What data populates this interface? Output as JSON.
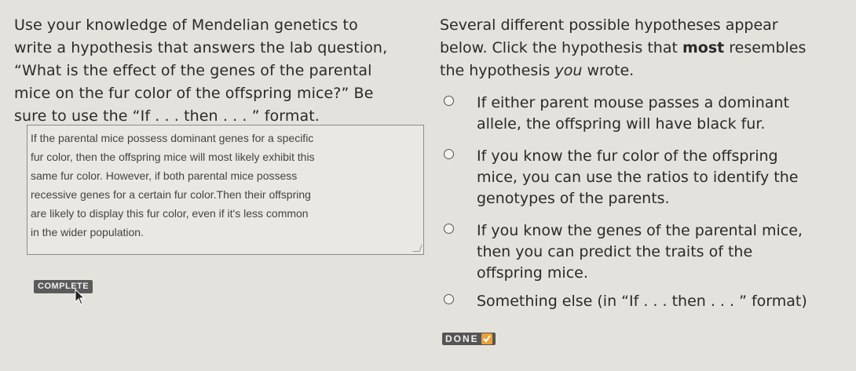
{
  "question": {
    "line1": "Use your knowledge of Mendelian genetics to",
    "line2": "write a hypothesis that answers the lab question,",
    "line3": "“What is the effect of the genes of the parental",
    "line4": "mice on the fur color of the offspring mice?” Be",
    "line5": "sure to use the “If . . . then . . . ” format."
  },
  "answer": {
    "text": "If the parental mice possess dominant genes for a specific\nfur color, then the offspring mice will most likely exhibit this\nsame fur color. However, if both parental mice possess\nrecessive genes for a certain fur color.Then their offspring\nare likely to display this fur color, even if it's less common\nin the wider population."
  },
  "complete_label": "COMPLETE",
  "instructions": {
    "line1": "Several different possible hypotheses appear",
    "line2a": "below. Click the hypothesis that ",
    "line2b": "most",
    "line2c": " resembles",
    "line3a": "the hypothesis ",
    "line3b": "you",
    "line3c": " wrote."
  },
  "options": [
    {
      "label": "If either parent mouse passes a dominant allele, the offspring will have black fur."
    },
    {
      "label": "If you know the fur color of the offspring mice, you can use the ratios to identify the genotypes of the parents."
    },
    {
      "label": "If you know the genes of the parental mice, then you can predict the traits of the offspring mice."
    },
    {
      "label": "Something else (in “If . . . then . . . ” format)"
    }
  ],
  "done_label": "DONE",
  "icons": {
    "cursor": "arrow-cursor-icon",
    "done_check": "check-icon",
    "radio": "radio-icon"
  },
  "colors": {
    "background": "#e4e2dc",
    "button": "#555555",
    "check_accent": "#e9a23b"
  }
}
